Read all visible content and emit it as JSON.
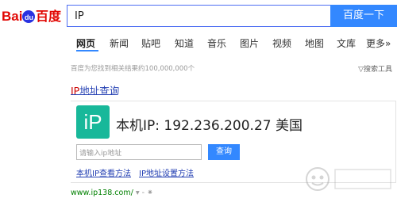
{
  "header": {
    "search_query": "IP",
    "search_button": "百度一下"
  },
  "nav": {
    "tabs": [
      "网页",
      "新闻",
      "贴吧",
      "知道",
      "音乐",
      "图片",
      "视频",
      "地图",
      "文库",
      "更多»"
    ]
  },
  "results": {
    "stats": "百度为您找到相关结果约100,000,000个",
    "tools": "搜索工具",
    "title_highlight": "IP",
    "title_rest": "地址查询",
    "widget": {
      "icon_text": "iP",
      "ip_line": "本机IP: 192.236.200.27  美国",
      "input_placeholder": "请输入ip地址",
      "query_button": "查询",
      "link1": "本机IP查看方法",
      "link2": "IP地址设置方法"
    },
    "url": "www.ip138.com/",
    "url_extra": "▾ - ⁕"
  },
  "colors": {
    "accent": "#3388ff",
    "link": "#2440b3",
    "ip_icon": "#18b89a",
    "url_green": "#008000"
  }
}
